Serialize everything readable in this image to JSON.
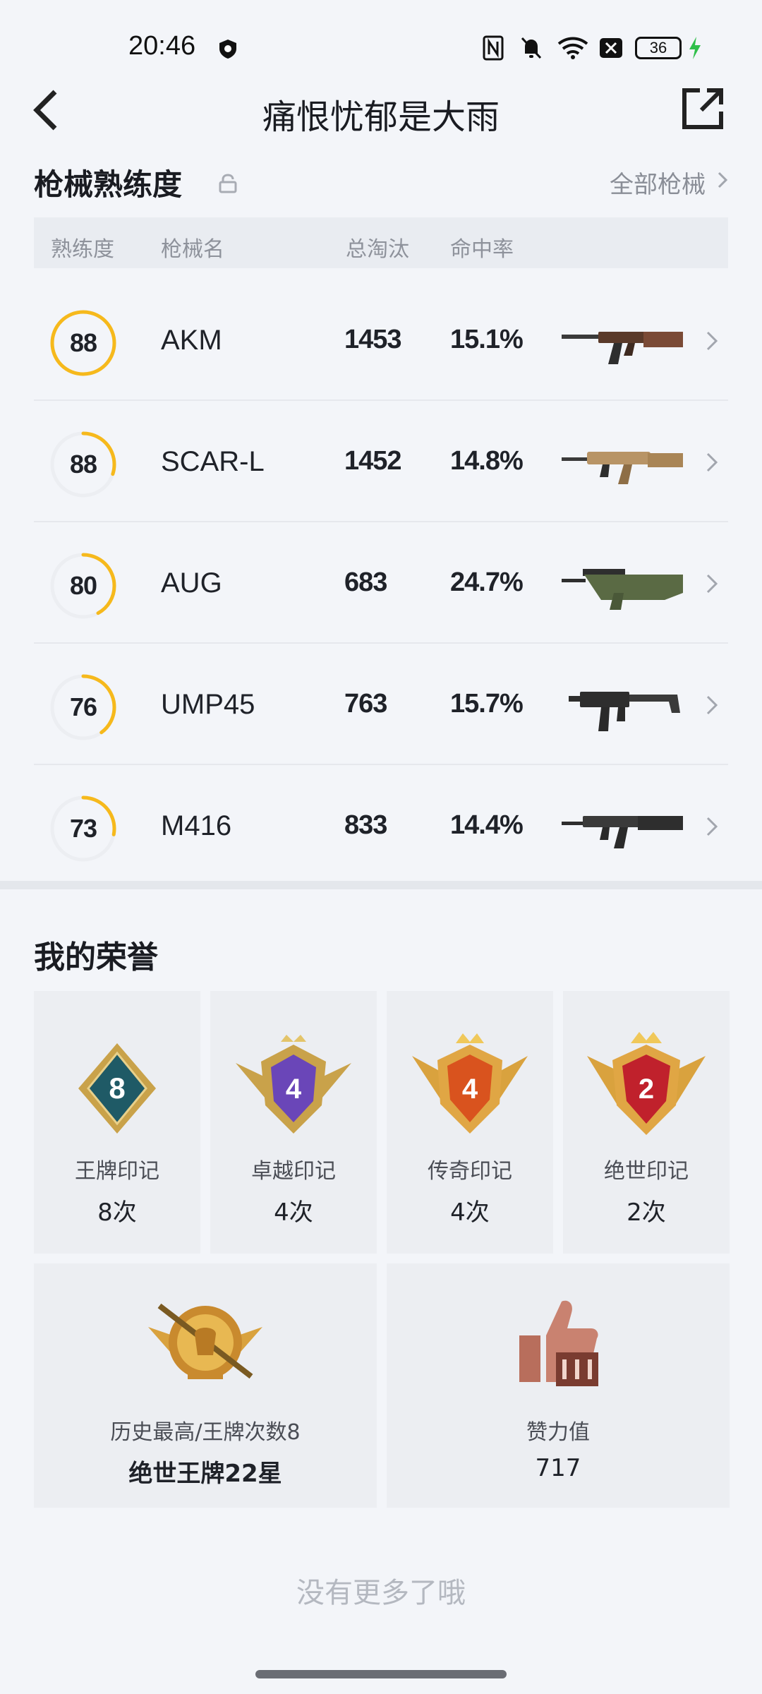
{
  "status_bar": {
    "time": "20:46",
    "battery": "36"
  },
  "header": {
    "title": "痛恨忧郁是大雨"
  },
  "weapons": {
    "title": "枪械熟练度",
    "all_link": "全部枪械",
    "columns": [
      "熟练度",
      "枪械名",
      "总淘汰",
      "命中率"
    ],
    "rows": [
      {
        "mastery": "88",
        "mastery_fraction": 1.0,
        "name": "AKM",
        "eliminations": "1453",
        "hit_rate": "15.1%",
        "icon": "akm-rifle-icon"
      },
      {
        "mastery": "88",
        "mastery_fraction": 0.3,
        "name": "SCAR-L",
        "eliminations": "1452",
        "hit_rate": "14.8%",
        "icon": "scar-l-rifle-icon"
      },
      {
        "mastery": "80",
        "mastery_fraction": 0.42,
        "name": "AUG",
        "eliminations": "683",
        "hit_rate": "24.7%",
        "icon": "aug-rifle-icon"
      },
      {
        "mastery": "76",
        "mastery_fraction": 0.4,
        "name": "UMP45",
        "eliminations": "763",
        "hit_rate": "15.7%",
        "icon": "ump45-smg-icon"
      },
      {
        "mastery": "73",
        "mastery_fraction": 0.28,
        "name": "M416",
        "eliminations": "833",
        "hit_rate": "14.4%",
        "icon": "m416-rifle-icon"
      }
    ],
    "ring_color": "#f6b91c"
  },
  "honors": {
    "title": "我的荣誉",
    "marks": [
      {
        "label": "王牌印记",
        "count": "8次",
        "badge_number": "8",
        "icon": "ace-mark-badge-icon",
        "color": "#1f5a66"
      },
      {
        "label": "卓越印记",
        "count": "4次",
        "badge_number": "4",
        "icon": "excellence-mark-badge-icon",
        "color": "#6a46b8"
      },
      {
        "label": "传奇印记",
        "count": "4次",
        "badge_number": "4",
        "icon": "legend-mark-badge-icon",
        "color": "#d9531e"
      },
      {
        "label": "绝世印记",
        "count": "2次",
        "badge_number": "2",
        "icon": "peerless-mark-badge-icon",
        "color": "#c0212c"
      }
    ],
    "best": {
      "label": "历史最高/王牌次数8",
      "value": "绝世王牌22星",
      "icon": "crown-rank-badge-icon"
    },
    "effort": {
      "label": "赞力值",
      "value": "717",
      "icon": "thumbs-up-iii-icon"
    }
  },
  "footer": {
    "no_more": "没有更多了哦"
  }
}
